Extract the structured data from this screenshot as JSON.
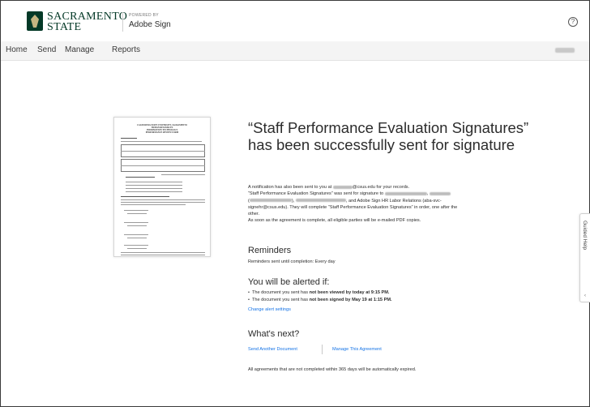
{
  "header": {
    "brand_line1": "SACRAMENTO",
    "brand_line2": "STATE",
    "powered_by": "POWERED BY",
    "product": "Adobe Sign",
    "help_icon": "?"
  },
  "nav": {
    "items": [
      "Home",
      "Send",
      "Manage",
      "Reports"
    ]
  },
  "document": {
    "header_lines": [
      "CALIFORNIA STATE UNIVERSITY, SACRAMENTO",
      "HUMAN RESOURCES",
      "INFORMATION TECHNOLOGY",
      "PERFORMANCE REVIEW FORM"
    ]
  },
  "main": {
    "title": "“Staff Performance Evaluation Signatures” has been successfully sent for signature",
    "notice": {
      "line1_pre": "A notification has also been sent to you at",
      "line1_post": "@csus.edu for your records.",
      "line2_pre": "“Staff Performance Evaluation Signatures” was sent for signature to",
      "line3_post": ", and Adobe Sign HR Labor Relations (aba-svc-",
      "line4": "signehr@csus.edu). They will complete “Staff Performance Evaluation Signatures” in order, one after the",
      "line5": "other.",
      "line6": "As soon as the agreement is complete, all eligible parties will be e-mailed PDF copies."
    },
    "reminders": {
      "heading": "Reminders",
      "text": "Reminders sent until completion: Every day"
    },
    "alerts": {
      "heading": "You will be alerted if:",
      "item1_pre": "The document you sent has",
      "item1_bold": "not been viewed by today at 9:15 PM.",
      "item2_pre": "The document you sent has",
      "item2_bold": "not been signed by May 19 at 1:15 PM.",
      "change_link": "Change alert settings"
    },
    "next": {
      "heading": "What's next?",
      "send_another": "Send Another Document",
      "manage": "Manage This Agreement",
      "expiry": "All agreements that are not completed within 365 days will be automatically expired."
    }
  },
  "guided_help": {
    "label": "Guided Help"
  },
  "colors": {
    "brand_green": "#043927",
    "brand_gold": "#c4b581",
    "link": "#1473e6"
  }
}
